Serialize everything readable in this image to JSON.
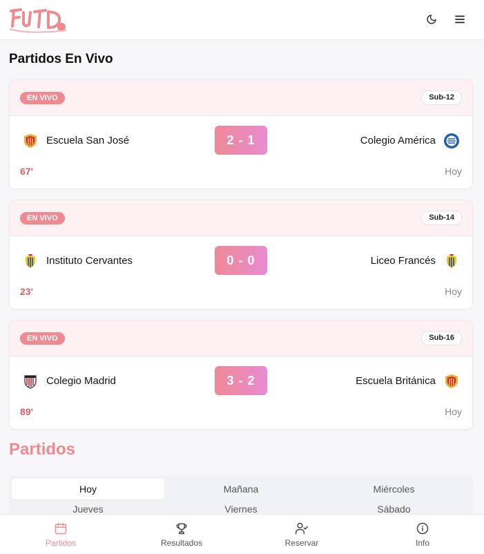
{
  "header": {
    "logo_text": "FUTD",
    "theme_toggle_icon": "moon-icon",
    "menu_icon": "hamburger-menu-icon"
  },
  "live_section": {
    "title": "Partidos En Vivo",
    "matches": [
      {
        "status": "EN VIVO",
        "category": "Sub-12",
        "home_team": "Escuela San José",
        "home_crest": "shield-crest-icon",
        "score": "2 - 1",
        "away_team": "Colegio América",
        "away_crest": "round-crest-icon",
        "minute": "67'",
        "day": "Hoy"
      },
      {
        "status": "EN VIVO",
        "category": "Sub-14",
        "home_team": "Instituto Cervantes",
        "home_crest": "shield-crest-icon",
        "score": "0 - 0",
        "away_team": "Liceo Francés",
        "away_crest": "shield-crest-icon",
        "minute": "23'",
        "day": "Hoy"
      },
      {
        "status": "EN VIVO",
        "category": "Sub-16",
        "home_team": "Colegio Madrid",
        "home_crest": "striped-crest-icon",
        "score": "3 - 2",
        "away_team": "Escuela Británica",
        "away_crest": "shield-crest-icon",
        "minute": "89'",
        "day": "Hoy"
      }
    ]
  },
  "partidos_section": {
    "title": "Partidos",
    "day_tabs": [
      "Hoy",
      "Mañana",
      "Miércoles",
      "Jueves",
      "Viernes",
      "Sábado"
    ],
    "active_tab": "Hoy"
  },
  "bottom_nav": {
    "items": [
      {
        "label": "Partidos",
        "icon": "calendar-icon"
      },
      {
        "label": "Resultados",
        "icon": "trophy-icon"
      },
      {
        "label": "Reservar",
        "icon": "user-check-icon"
      },
      {
        "label": "Info",
        "icon": "info-icon"
      }
    ]
  },
  "colors": {
    "accent": "#ef8a90",
    "score_gradient_start": "#ee8994",
    "score_gradient_end": "#e98bd3",
    "live_minute": "#e25b67"
  }
}
